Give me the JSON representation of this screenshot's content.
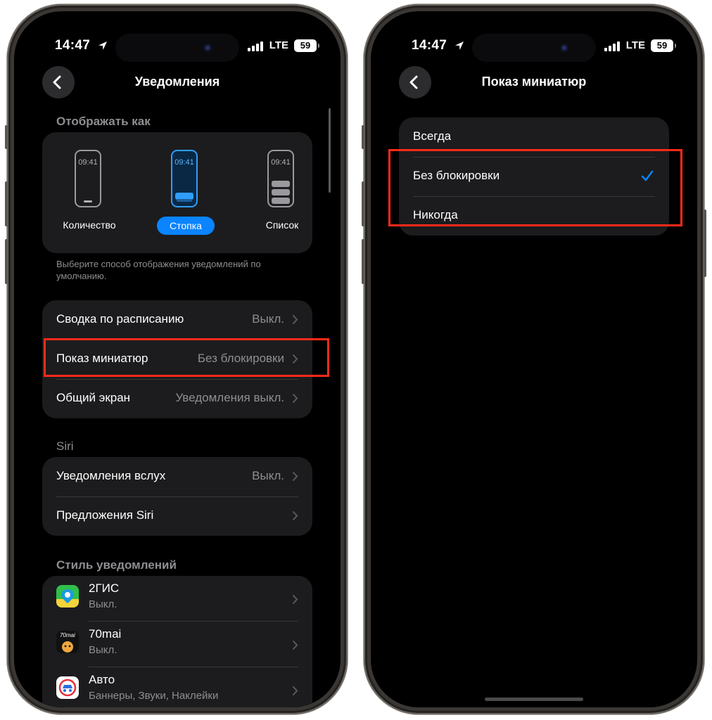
{
  "status_bar": {
    "time": "14:47",
    "network": "LTE",
    "battery": "59"
  },
  "left": {
    "title": "Уведомления",
    "display_section": {
      "header": "Отображать как",
      "modes": [
        {
          "label": "Количество",
          "clock": "09:41"
        },
        {
          "label": "Стопка",
          "clock": "09:41",
          "selected": true
        },
        {
          "label": "Список",
          "clock": "09:41"
        }
      ],
      "footnote": "Выберите способ отображения уведомлений по умолчанию."
    },
    "settings": [
      {
        "label": "Сводка по расписанию",
        "value": "Выкл."
      },
      {
        "label": "Показ миниатюр",
        "value": "Без блокировки"
      },
      {
        "label": "Общий экран",
        "value": "Уведомления выкл."
      }
    ],
    "siri_section": {
      "header": "Siri",
      "items": [
        {
          "label": "Уведомления вслух",
          "value": "Выкл."
        },
        {
          "label": "Предложения Siri",
          "value": ""
        }
      ]
    },
    "style_section": {
      "header": "Стиль уведомлений",
      "apps": [
        {
          "name": "2ГИС",
          "status": "Выкл.",
          "icon": "2gis-app-icon"
        },
        {
          "name": "70mai",
          "status": "Выкл.",
          "icon": "70mai-app-icon",
          "icon_text": "70mai"
        },
        {
          "name": "Авто",
          "status": "Баннеры, Звуки, Наклейки",
          "icon": "avto-app-icon"
        }
      ]
    }
  },
  "right": {
    "title": "Показ миниатюр",
    "options": [
      {
        "label": "Всегда"
      },
      {
        "label": "Без блокировки",
        "selected": true
      },
      {
        "label": "Никогда"
      }
    ]
  },
  "colors": {
    "accent": "#0a84ff",
    "highlight": "#ff2a1a",
    "cell": "#1c1c1e",
    "secondary_text": "#8e8e93"
  }
}
